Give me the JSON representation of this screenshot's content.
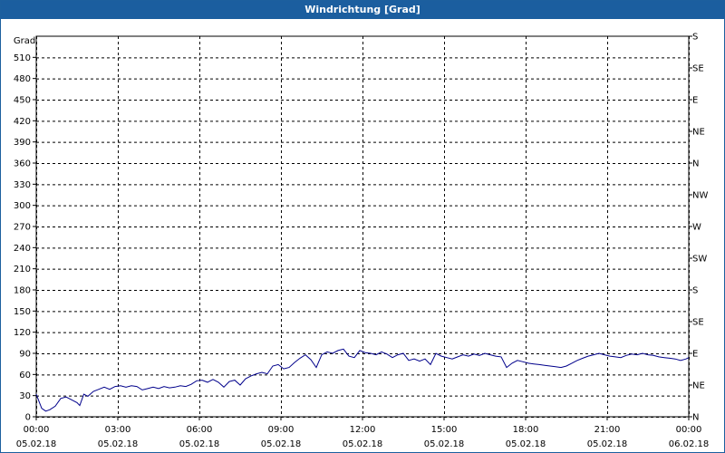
{
  "window": {
    "title": "Windrichtung [Grad]"
  },
  "chart_data": {
    "type": "line",
    "title": "Windrichtung [Grad]",
    "ylabel": "Grad",
    "xlabel": "",
    "ylim": [
      0,
      540
    ],
    "yticks": [
      0,
      30,
      60,
      90,
      120,
      150,
      180,
      210,
      240,
      270,
      300,
      330,
      360,
      390,
      420,
      450,
      480,
      510
    ],
    "right_axis": {
      "ticks": [
        {
          "value": 0,
          "label": "N"
        },
        {
          "value": 45,
          "label": "NE"
        },
        {
          "value": 90,
          "label": "E"
        },
        {
          "value": 135,
          "label": "SE"
        },
        {
          "value": 180,
          "label": "S"
        },
        {
          "value": 225,
          "label": "SW"
        },
        {
          "value": 270,
          "label": "W"
        },
        {
          "value": 315,
          "label": "NW"
        },
        {
          "value": 360,
          "label": "N"
        },
        {
          "value": 405,
          "label": "NE"
        },
        {
          "value": 450,
          "label": "E"
        },
        {
          "value": 495,
          "label": "SE"
        },
        {
          "value": 540,
          "label": "S"
        }
      ]
    },
    "x_range_hours": [
      0,
      24
    ],
    "xticks": [
      {
        "hour": 0,
        "time": "00:00",
        "date": "05.02.18"
      },
      {
        "hour": 3,
        "time": "03:00",
        "date": "05.02.18"
      },
      {
        "hour": 6,
        "time": "06:00",
        "date": "05.02.18"
      },
      {
        "hour": 9,
        "time": "09:00",
        "date": "05.02.18"
      },
      {
        "hour": 12,
        "time": "12:00",
        "date": "05.02.18"
      },
      {
        "hour": 15,
        "time": "15:00",
        "date": "05.02.18"
      },
      {
        "hour": 18,
        "time": "18:00",
        "date": "05.02.18"
      },
      {
        "hour": 21,
        "time": "21:00",
        "date": "05.02.18"
      },
      {
        "hour": 24,
        "time": "00:00",
        "date": "06.02.18"
      }
    ],
    "grid": true,
    "series": [
      {
        "color": "#00008b",
        "points": [
          [
            0.0,
            32
          ],
          [
            0.1,
            22
          ],
          [
            0.2,
            12
          ],
          [
            0.35,
            8
          ],
          [
            0.5,
            10
          ],
          [
            0.7,
            15
          ],
          [
            0.9,
            26
          ],
          [
            1.1,
            28
          ],
          [
            1.3,
            24
          ],
          [
            1.5,
            20
          ],
          [
            1.6,
            16
          ],
          [
            1.75,
            32
          ],
          [
            1.9,
            29
          ],
          [
            2.1,
            36
          ],
          [
            2.3,
            39
          ],
          [
            2.5,
            42
          ],
          [
            2.7,
            39
          ],
          [
            2.9,
            43
          ],
          [
            3.1,
            44
          ],
          [
            3.3,
            42
          ],
          [
            3.5,
            44
          ],
          [
            3.7,
            43
          ],
          [
            3.9,
            38
          ],
          [
            4.1,
            40
          ],
          [
            4.3,
            42
          ],
          [
            4.5,
            40
          ],
          [
            4.7,
            43
          ],
          [
            4.9,
            41
          ],
          [
            5.1,
            42
          ],
          [
            5.3,
            44
          ],
          [
            5.5,
            43
          ],
          [
            5.7,
            46
          ],
          [
            5.9,
            51
          ],
          [
            6.1,
            52
          ],
          [
            6.3,
            49
          ],
          [
            6.5,
            53
          ],
          [
            6.7,
            49
          ],
          [
            6.9,
            42
          ],
          [
            7.1,
            50
          ],
          [
            7.3,
            52
          ],
          [
            7.5,
            45
          ],
          [
            7.7,
            54
          ],
          [
            7.9,
            58
          ],
          [
            8.1,
            61
          ],
          [
            8.3,
            63
          ],
          [
            8.5,
            61
          ],
          [
            8.7,
            72
          ],
          [
            8.9,
            74
          ],
          [
            9.1,
            68
          ],
          [
            9.3,
            70
          ],
          [
            9.5,
            77
          ],
          [
            9.7,
            83
          ],
          [
            9.9,
            88
          ],
          [
            10.1,
            81
          ],
          [
            10.3,
            70
          ],
          [
            10.5,
            88
          ],
          [
            10.7,
            92
          ],
          [
            10.9,
            90
          ],
          [
            11.1,
            94
          ],
          [
            11.3,
            96
          ],
          [
            11.5,
            86
          ],
          [
            11.7,
            84
          ],
          [
            11.9,
            94
          ],
          [
            12.1,
            91
          ],
          [
            12.3,
            90
          ],
          [
            12.5,
            88
          ],
          [
            12.7,
            92
          ],
          [
            12.9,
            89
          ],
          [
            13.1,
            84
          ],
          [
            13.3,
            88
          ],
          [
            13.5,
            90
          ],
          [
            13.7,
            80
          ],
          [
            13.9,
            82
          ],
          [
            14.1,
            79
          ],
          [
            14.3,
            82
          ],
          [
            14.5,
            74
          ],
          [
            14.7,
            90
          ],
          [
            14.9,
            86
          ],
          [
            15.1,
            84
          ],
          [
            15.3,
            82
          ],
          [
            15.5,
            85
          ],
          [
            15.7,
            88
          ],
          [
            15.9,
            86
          ],
          [
            16.1,
            89
          ],
          [
            16.3,
            87
          ],
          [
            16.5,
            90
          ],
          [
            16.7,
            88
          ],
          [
            16.9,
            86
          ],
          [
            17.1,
            85
          ],
          [
            17.3,
            70
          ],
          [
            17.5,
            76
          ],
          [
            17.7,
            80
          ],
          [
            17.9,
            78
          ],
          [
            18.1,
            76
          ],
          [
            18.3,
            75
          ],
          [
            18.5,
            74
          ],
          [
            18.7,
            73
          ],
          [
            18.9,
            72
          ],
          [
            19.1,
            71
          ],
          [
            19.3,
            70
          ],
          [
            19.5,
            72
          ],
          [
            19.7,
            76
          ],
          [
            19.9,
            80
          ],
          [
            20.1,
            83
          ],
          [
            20.3,
            86
          ],
          [
            20.5,
            88
          ],
          [
            20.7,
            90
          ],
          [
            20.9,
            88
          ],
          [
            21.1,
            86
          ],
          [
            21.3,
            85
          ],
          [
            21.5,
            84
          ],
          [
            21.7,
            87
          ],
          [
            21.9,
            89
          ],
          [
            22.1,
            88
          ],
          [
            22.3,
            90
          ],
          [
            22.5,
            88
          ],
          [
            22.7,
            87
          ],
          [
            22.9,
            85
          ],
          [
            23.1,
            84
          ],
          [
            23.3,
            83
          ],
          [
            23.5,
            82
          ],
          [
            23.7,
            80
          ],
          [
            23.9,
            82
          ],
          [
            24.0,
            84
          ]
        ]
      }
    ]
  }
}
